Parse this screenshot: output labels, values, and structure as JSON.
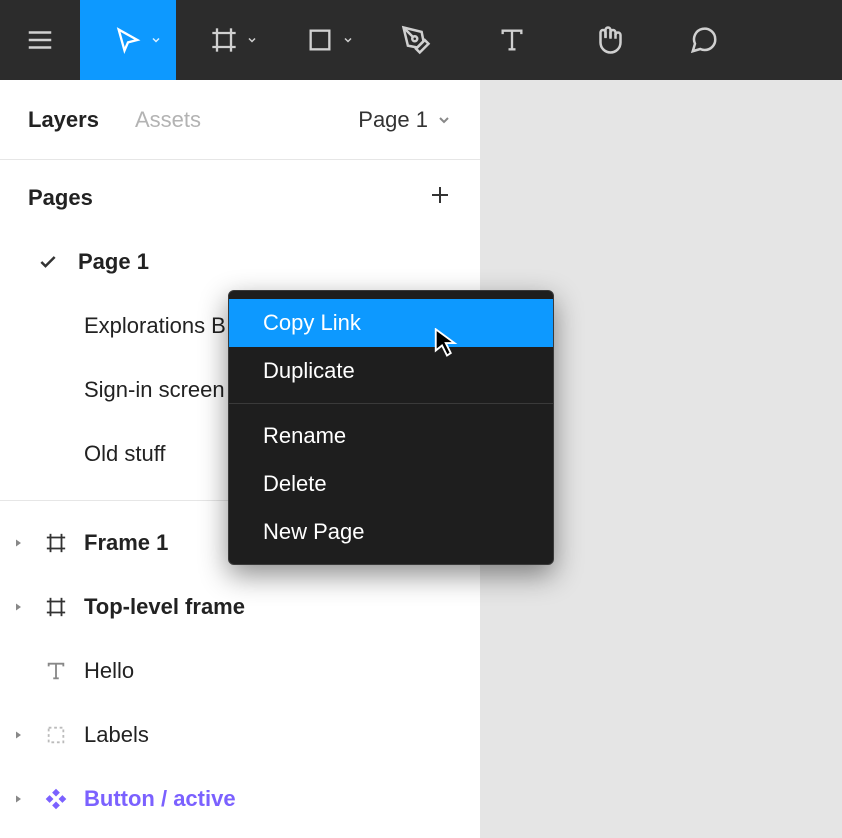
{
  "toolbar": {
    "tools": [
      "menu",
      "move",
      "frame",
      "shape",
      "pen",
      "text",
      "hand",
      "comment"
    ],
    "active_index": 1
  },
  "sidebar": {
    "tabs": {
      "layers": "Layers",
      "assets": "Assets"
    },
    "page_selector_label": "Page 1",
    "pages_header": "Pages",
    "pages": [
      {
        "name": "Page 1",
        "current": true
      },
      {
        "name": "Explorations B",
        "current": false
      },
      {
        "name": "Sign-in screen",
        "current": false
      },
      {
        "name": "Old stuff",
        "current": false
      }
    ],
    "layers": [
      {
        "name": "Frame 1",
        "type": "frame",
        "hasChildren": true
      },
      {
        "name": "Top-level frame",
        "type": "frame",
        "hasChildren": true
      },
      {
        "name": "Hello",
        "type": "text",
        "hasChildren": false
      },
      {
        "name": "Labels",
        "type": "group",
        "hasChildren": true
      },
      {
        "name": "Button / active",
        "type": "component",
        "hasChildren": true
      }
    ]
  },
  "context_menu": {
    "items_a": [
      "Copy Link",
      "Duplicate"
    ],
    "items_b": [
      "Rename",
      "Delete",
      "New Page"
    ],
    "highlighted": "Copy Link"
  }
}
